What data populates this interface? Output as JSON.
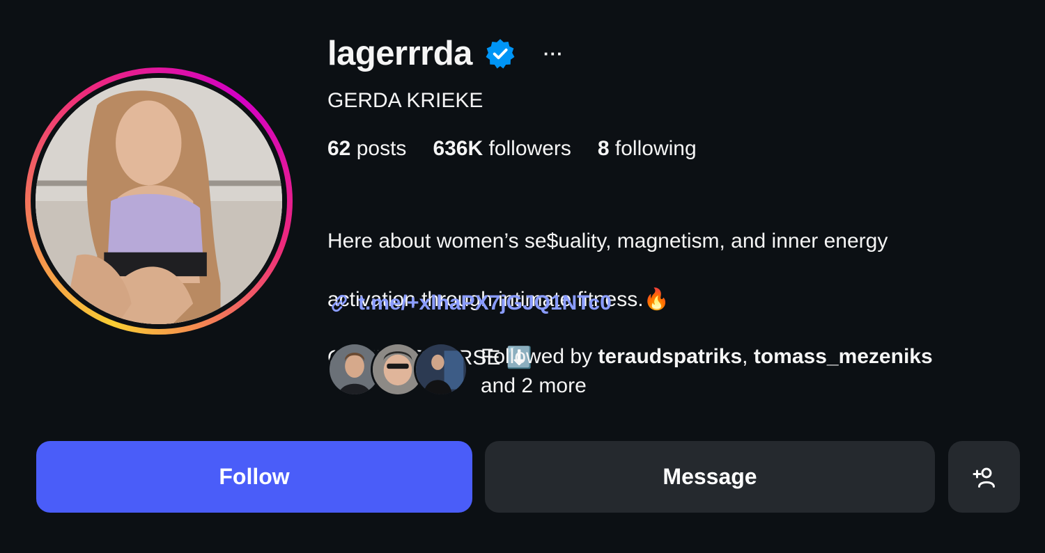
{
  "profile": {
    "username": "lagerrrda",
    "full_name": "GERDA KRIEKE",
    "verified": true,
    "more_label": "···",
    "stats": {
      "posts_count": "62",
      "posts_label": "posts",
      "followers_count": "636K",
      "followers_label": "followers",
      "following_count": "8",
      "following_label": "following"
    },
    "bio": {
      "line1": "Here about women’s se$uality, magnetism, and inner energy",
      "line2": "activation through intimate fitness.🔥",
      "line3": "ONLINE COURSE ⬇️"
    },
    "link": "t.me/+xlhaPX7jGJQ1NTc0",
    "followed_by": {
      "prefix": "Followed by ",
      "user1": "teraudspatriks",
      "separator": ", ",
      "user2": "tomass_mezeniks",
      "suffix": "and 2 more"
    }
  },
  "actions": {
    "follow_label": "Follow",
    "message_label": "Message",
    "suggest_icon": "add-person-icon"
  },
  "colors": {
    "background": "#0c1014",
    "follow_button": "#4a5df9",
    "secondary_button": "#25292e",
    "link": "#8a9cff",
    "verified_badge": "#0095f6"
  }
}
